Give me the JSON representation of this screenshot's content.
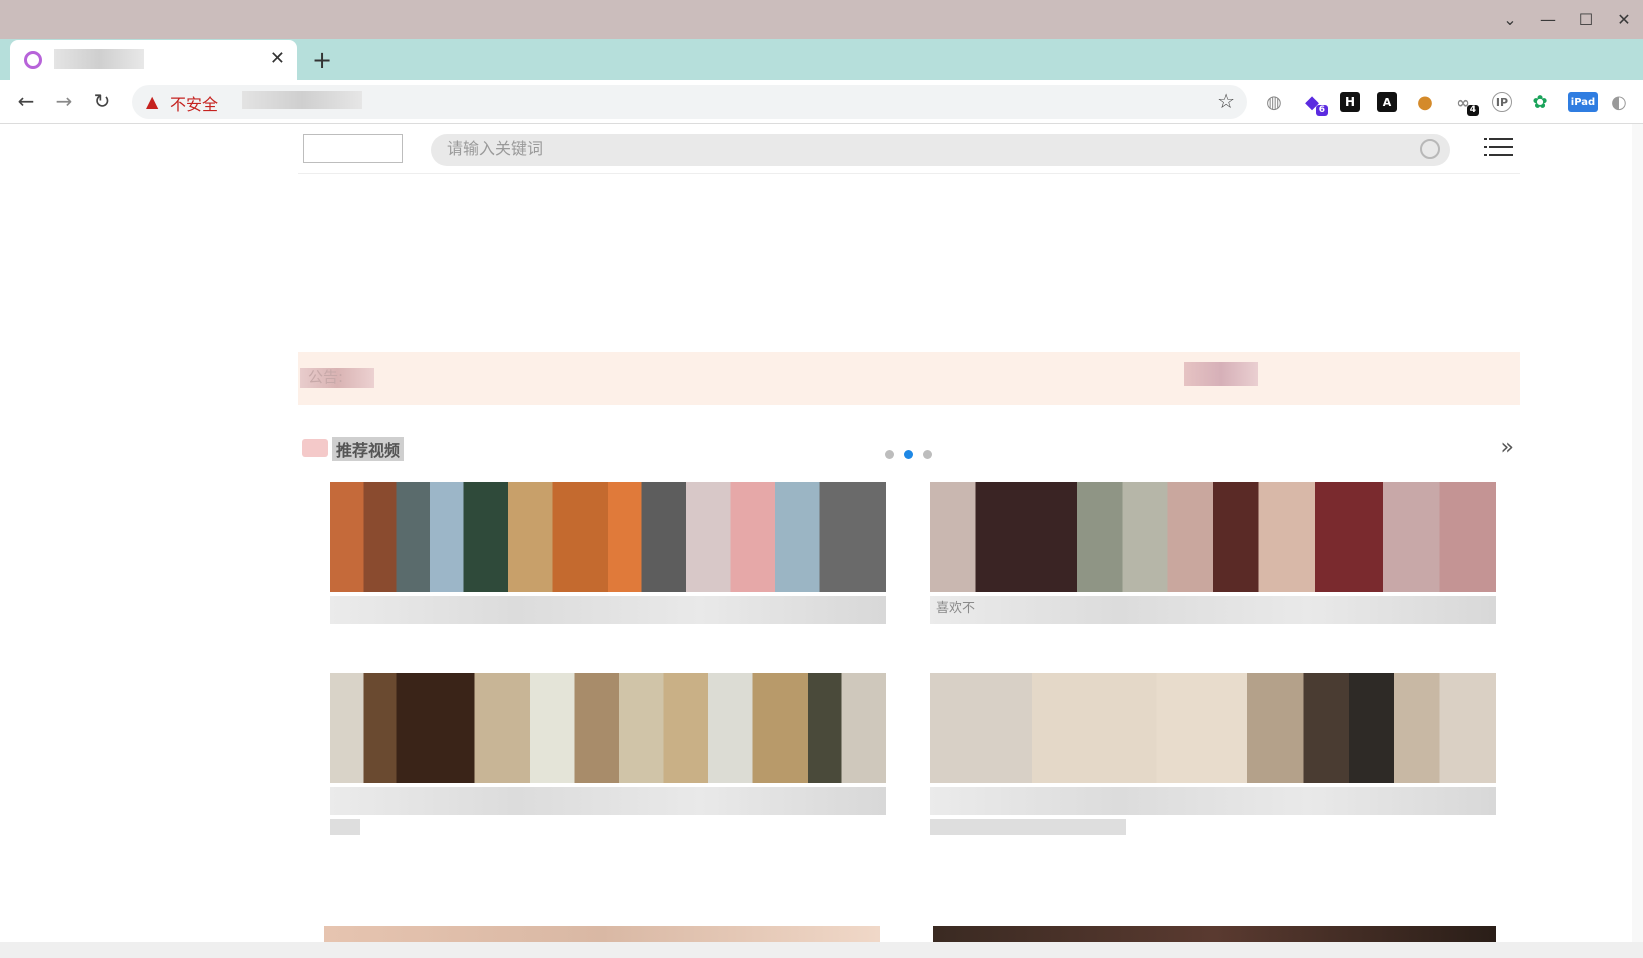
{
  "browser": {
    "tab_title": "",
    "tab_close": "✕",
    "new_tab": "+",
    "security_label": "不安全",
    "url": "",
    "extensions": [
      {
        "name": "globe-ext-icon",
        "glyph": "◍",
        "badge": ""
      },
      {
        "name": "cube-ext-icon",
        "glyph": "◆",
        "badge": "6"
      },
      {
        "name": "h-ext-icon",
        "glyph": "H",
        "badge": ""
      },
      {
        "name": "aitab-ext-icon",
        "glyph": "A",
        "badge": ""
      },
      {
        "name": "cookie-ext-icon",
        "glyph": "●",
        "badge": ""
      },
      {
        "name": "link-ext-icon",
        "glyph": "∞",
        "badge": "4"
      },
      {
        "name": "ip-ext-icon",
        "glyph": "IP",
        "badge": ""
      },
      {
        "name": "gear-ext-icon",
        "glyph": "✿",
        "badge": ""
      },
      {
        "name": "ipad-ext-icon",
        "glyph": "iPad",
        "badge": ""
      },
      {
        "name": "mouse-ext-icon",
        "glyph": "◐",
        "badge": ""
      }
    ]
  },
  "site": {
    "search_placeholder": "请输入关键词",
    "notice_label": "公告:",
    "section_title": "推荐视频",
    "more_glyph": "»",
    "videos": [
      {
        "caption": "",
        "meta": ""
      },
      {
        "caption": "喜欢不",
        "meta": ""
      },
      {
        "caption": "",
        "meta": ""
      },
      {
        "caption": "",
        "meta": ""
      }
    ]
  },
  "colors": {
    "titlebar": "#cbbdbc",
    "tabstrip": "#b6dfdb",
    "insecure": "#c5221f",
    "notice_bg": "#fdf0e8",
    "carousel_active": "#1e88e5"
  }
}
